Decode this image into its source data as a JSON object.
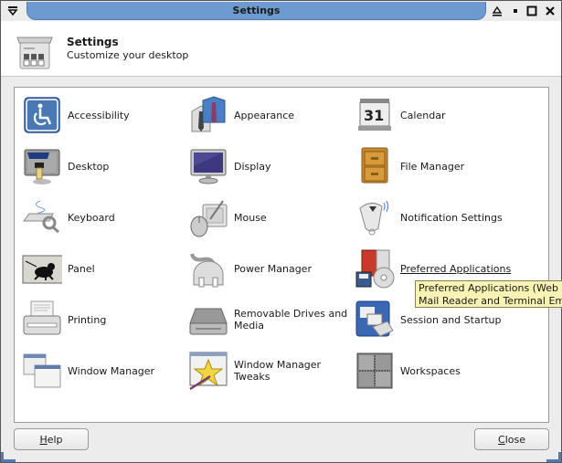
{
  "window": {
    "title": "Settings",
    "controls": [
      "menu",
      "shade",
      "minimize",
      "maximize",
      "close"
    ]
  },
  "header": {
    "title": "Settings",
    "subtitle": "Customize your desktop"
  },
  "items": [
    {
      "label": "Accessibility",
      "icon": "accessibility-icon"
    },
    {
      "label": "Appearance",
      "icon": "appearance-icon"
    },
    {
      "label": "Calendar",
      "icon": "calendar-icon",
      "icon_text": "31"
    },
    {
      "label": "Desktop",
      "icon": "desktop-icon"
    },
    {
      "label": "Display",
      "icon": "display-icon"
    },
    {
      "label": "File Manager",
      "icon": "file-manager-icon"
    },
    {
      "label": "Keyboard",
      "icon": "keyboard-icon"
    },
    {
      "label": "Mouse",
      "icon": "mouse-icon"
    },
    {
      "label": "Notification Settings",
      "icon": "notification-icon"
    },
    {
      "label": "Panel",
      "icon": "panel-icon"
    },
    {
      "label": "Power Manager",
      "icon": "power-manager-icon"
    },
    {
      "label": "Preferred Applications",
      "icon": "preferred-applications-icon",
      "hovered": true
    },
    {
      "label": "Printing",
      "icon": "printer-icon"
    },
    {
      "label": "Removable Drives and Media",
      "icon": "removable-drive-icon"
    },
    {
      "label": "Session and Startup",
      "icon": "session-startup-icon"
    },
    {
      "label": "Window Manager",
      "icon": "window-manager-icon"
    },
    {
      "label": "Window Manager Tweaks",
      "icon": "window-manager-tweaks-icon"
    },
    {
      "label": "Workspaces",
      "icon": "workspaces-icon"
    }
  ],
  "tooltip": {
    "line1": "Preferred Applications (Web Browser,",
    "line2": "Mail Reader and Terminal Emulator)"
  },
  "buttons": {
    "help": {
      "mnemonic": "H",
      "rest": "elp"
    },
    "close": {
      "mnemonic": "C",
      "rest": "lose"
    }
  },
  "colors": {
    "title_accent": "#6d9bd0",
    "tooltip_bg": "#f8f3b4"
  }
}
